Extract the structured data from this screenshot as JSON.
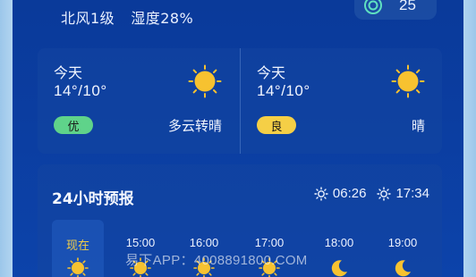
{
  "current": {
    "wind": "北风1级",
    "humidity": "湿度28%",
    "aqi_value": "25"
  },
  "days": [
    {
      "label": "今天",
      "temp": "14°/10°",
      "air_quality": "优",
      "condition": "多云转晴",
      "icon": "sun-icon",
      "badge_color": "#5fd38a"
    },
    {
      "label": "今天",
      "temp": "14°/10°",
      "air_quality": "良",
      "condition": "晴",
      "icon": "sun-icon",
      "badge_color": "#f5cf46"
    }
  ],
  "hourly": {
    "title": "24小时预报",
    "sunrise": "06:26",
    "sunset": "17:34",
    "items": [
      {
        "time": "现在",
        "icon": "sun-icon"
      },
      {
        "time": "15:00",
        "icon": "sun-icon"
      },
      {
        "time": "16:00",
        "icon": "sun-icon"
      },
      {
        "time": "17:00",
        "icon": "sun-icon"
      },
      {
        "time": "18:00",
        "icon": "moon-icon"
      },
      {
        "time": "19:00",
        "icon": "moon-icon"
      }
    ]
  },
  "watermark": "易下APP：4008891800.COM",
  "colors": {
    "accent_yellow": "#f5cf46",
    "good_green": "#5fd38a",
    "sun": "#f7c230"
  }
}
